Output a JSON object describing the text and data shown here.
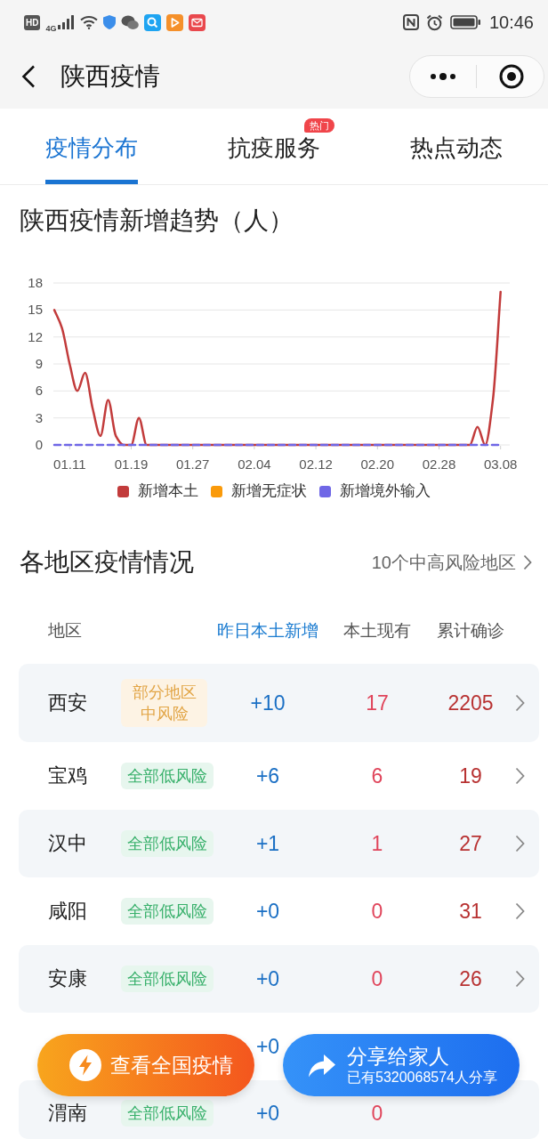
{
  "status_bar": {
    "badge": "HD",
    "network": "4G",
    "time": "10:46"
  },
  "header": {
    "title": "陕西疫情"
  },
  "tabs": [
    {
      "label": "疫情分布",
      "selected": true
    },
    {
      "label": "抗疫服务",
      "selected": false,
      "badge": "热门"
    },
    {
      "label": "热点动态",
      "selected": false
    }
  ],
  "trend": {
    "title": "陕西疫情新增趋势（人）",
    "chart_data": {
      "type": "line",
      "grid": true,
      "legend": "bottom",
      "categories": [
        null,
        null,
        "01.11",
        null,
        null,
        null,
        null,
        null,
        null,
        null,
        "01.19",
        null,
        null,
        null,
        null,
        null,
        null,
        null,
        "01.27",
        null,
        null,
        null,
        null,
        null,
        null,
        null,
        "02.04",
        null,
        null,
        null,
        null,
        null,
        null,
        null,
        "02.12",
        null,
        null,
        null,
        null,
        null,
        null,
        null,
        "02.20",
        null,
        null,
        null,
        null,
        null,
        null,
        null,
        "02.28",
        null,
        null,
        null,
        null,
        null,
        null,
        null,
        "03.08"
      ],
      "ylim": [
        0,
        18
      ],
      "yticks": [
        0,
        3,
        6,
        9,
        12,
        15,
        18
      ],
      "series": [
        {
          "name": "新增本土",
          "color": "#c23b3b",
          "line_style": "solid",
          "values": [
            15,
            13,
            9,
            6,
            8,
            4,
            1,
            5,
            1,
            0,
            0,
            3,
            0,
            0,
            0,
            0,
            0,
            0,
            0,
            0,
            0,
            0,
            0,
            0,
            0,
            0,
            0,
            0,
            0,
            0,
            0,
            0,
            0,
            0,
            0,
            0,
            0,
            0,
            0,
            0,
            0,
            0,
            0,
            0,
            0,
            0,
            0,
            0,
            0,
            0,
            0,
            0,
            0,
            0,
            0,
            2,
            0,
            5,
            17
          ]
        },
        {
          "name": "新增无症状",
          "color": "#fa9a0a",
          "values": [
            null,
            null,
            null,
            null,
            null,
            null,
            null,
            null,
            null,
            null,
            null,
            null,
            null,
            null,
            null,
            null,
            null,
            null,
            null,
            null,
            null,
            null,
            null,
            null,
            null,
            null,
            null,
            null,
            null,
            null,
            null,
            null,
            null,
            null,
            null,
            null,
            null,
            null,
            null,
            null,
            null,
            null,
            null,
            null,
            null,
            null,
            null,
            null,
            null,
            null,
            null,
            null,
            null,
            null,
            null,
            null,
            null,
            null,
            null
          ]
        },
        {
          "name": "新增境外输入",
          "color": "#6f67e6",
          "line_style": "dashed",
          "values": [
            0,
            0,
            0,
            0,
            0,
            0,
            0,
            0,
            0,
            0,
            0,
            0,
            0,
            0,
            0,
            0,
            0,
            0,
            0,
            0,
            0,
            0,
            0,
            0,
            0,
            0,
            0,
            0,
            0,
            0,
            0,
            0,
            0,
            0,
            0,
            0,
            0,
            0,
            0,
            0,
            0,
            0,
            0,
            0,
            0,
            0,
            0,
            0,
            0,
            0,
            0,
            0,
            0,
            0,
            0,
            0,
            0,
            0,
            0
          ]
        }
      ]
    }
  },
  "regions": {
    "title": "各地区疫情情况",
    "link": "10个中高风险地区",
    "columns": [
      {
        "label": "地区",
        "selected": false
      },
      {
        "label": "昨日本土新增",
        "selected": true
      },
      {
        "label": "本土现有",
        "selected": false
      },
      {
        "label": "累计确诊",
        "selected": false
      }
    ],
    "rows": [
      {
        "region": "西安",
        "risk": {
          "text": "部分地区中风险",
          "kind": "medium"
        },
        "change": "+10",
        "current": "17",
        "total": "2205"
      },
      {
        "region": "宝鸡",
        "risk": {
          "text": "全部低风险",
          "kind": "low"
        },
        "change": "+6",
        "current": "6",
        "total": "19"
      },
      {
        "region": "汉中",
        "risk": {
          "text": "全部低风险",
          "kind": "low"
        },
        "change": "+1",
        "current": "1",
        "total": "27"
      },
      {
        "region": "咸阳",
        "risk": {
          "text": "全部低风险",
          "kind": "low"
        },
        "change": "+0",
        "current": "0",
        "total": "31"
      },
      {
        "region": "安康",
        "risk": {
          "text": "全部低风险",
          "kind": "low"
        },
        "change": "+0",
        "current": "0",
        "total": "26"
      },
      {
        "change": "+0"
      },
      {
        "region": "渭南",
        "risk": {
          "text": "全部低风险",
          "kind": "low"
        },
        "change": "+0",
        "current": "0"
      }
    ]
  },
  "actions": [
    {
      "kind": "national",
      "label": "查看全国疫情"
    },
    {
      "kind": "share",
      "label": "分享给家人",
      "note": "已有5320068574人分享"
    }
  ]
}
